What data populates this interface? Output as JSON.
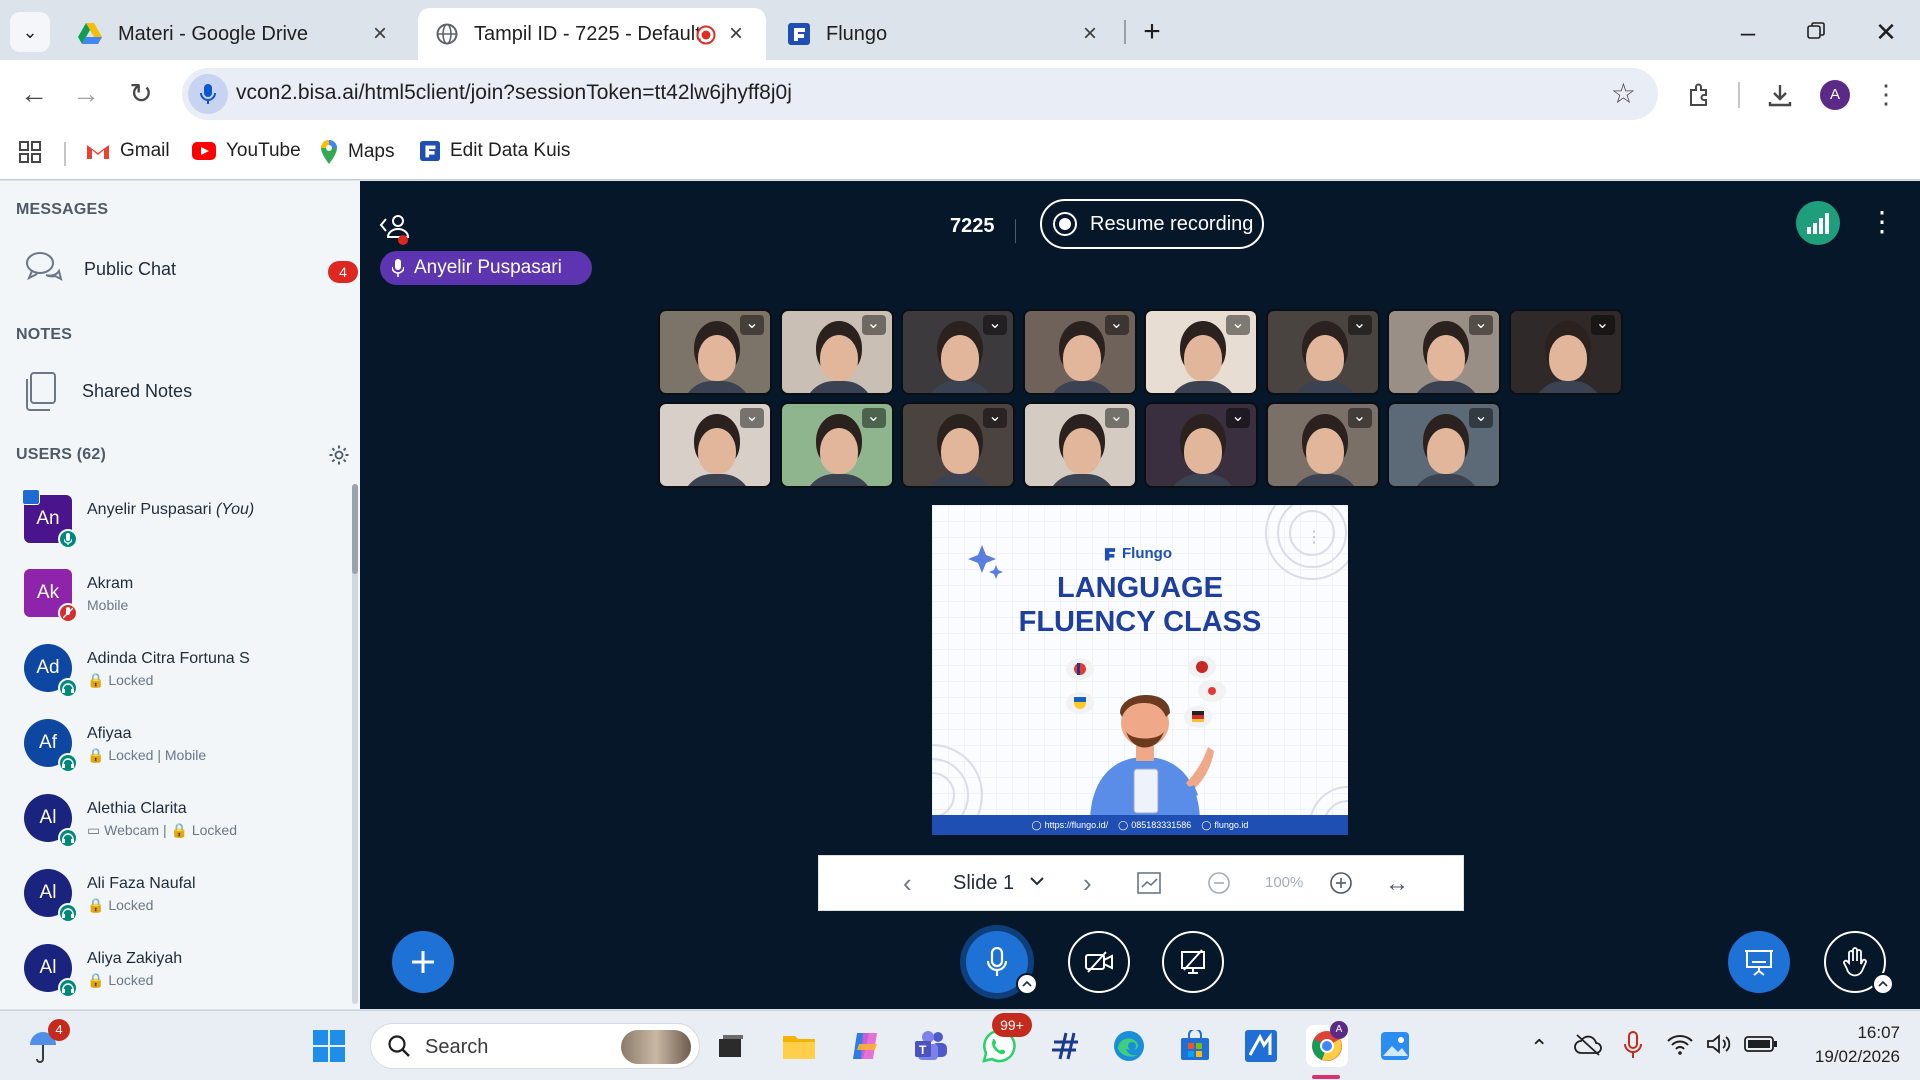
{
  "browser": {
    "tabs": [
      {
        "title": "Materi - Google Drive",
        "icon": "google-drive-icon"
      },
      {
        "title": "Tampil ID - 7225 - Default",
        "icon": "globe-icon",
        "recording": true
      },
      {
        "title": "Flungo",
        "icon": "flungo-icon"
      }
    ],
    "new_tab": "+",
    "url": "vcon2.bisa.ai/html5client/join?sessionToken=tt42lw6jhyff8j0j",
    "profile_initial": "A",
    "bookmarks": [
      "Gmail",
      "YouTube",
      "Maps",
      "Edit Data Kuis"
    ]
  },
  "sidebar": {
    "messages_title": "MESSAGES",
    "public_chat": "Public Chat",
    "public_chat_unread": "4",
    "notes_title": "NOTES",
    "shared_notes": "Shared Notes",
    "users_title": "USERS (62)",
    "users": [
      {
        "initials": "An",
        "name": "Anyelir Puspasari",
        "you": "(You)",
        "sub": "",
        "color": "#4a148c",
        "status": "mic"
      },
      {
        "initials": "Ak",
        "name": "Akram",
        "sub": "Mobile",
        "color": "#8e24aa",
        "status": "muted"
      },
      {
        "initials": "Ad",
        "name": "Adinda Citra Fortuna S",
        "sub": "🔒 Locked",
        "color": "#0d47a1",
        "status": "listen"
      },
      {
        "initials": "Af",
        "name": "Afiyaa",
        "sub": "🔒 Locked | Mobile",
        "color": "#0d47a1",
        "status": "listen"
      },
      {
        "initials": "Al",
        "name": "Alethia Clarita",
        "sub": "▭ Webcam | 🔒 Locked",
        "color": "#1a237e",
        "status": "listen"
      },
      {
        "initials": "Al",
        "name": "Ali Faza Naufal",
        "sub": "🔒 Locked",
        "color": "#1a237e",
        "status": "listen"
      },
      {
        "initials": "Al",
        "name": "Aliya Zakiyah",
        "sub": "🔒 Locked",
        "color": "#1a237e",
        "status": "listen"
      }
    ]
  },
  "meeting": {
    "room_id": "7225",
    "recording_label": "Resume recording",
    "talking_indicator": "Anyelir Puspasari",
    "tile_count": 15
  },
  "slide": {
    "brand": "Flungo",
    "headline_1": "LANGUAGE",
    "headline_2": "FLUENCY CLASS",
    "footer_site": "https://flungo.id/",
    "footer_phone": "085183331586",
    "footer_web": "flungo.id",
    "nav_label": "Slide 1",
    "zoom": "100%"
  },
  "taskbar": {
    "notification_count": "4",
    "search_placeholder": "Search",
    "whatsapp_badge": "99+",
    "time": "16:07",
    "date": "19/02/2026"
  }
}
